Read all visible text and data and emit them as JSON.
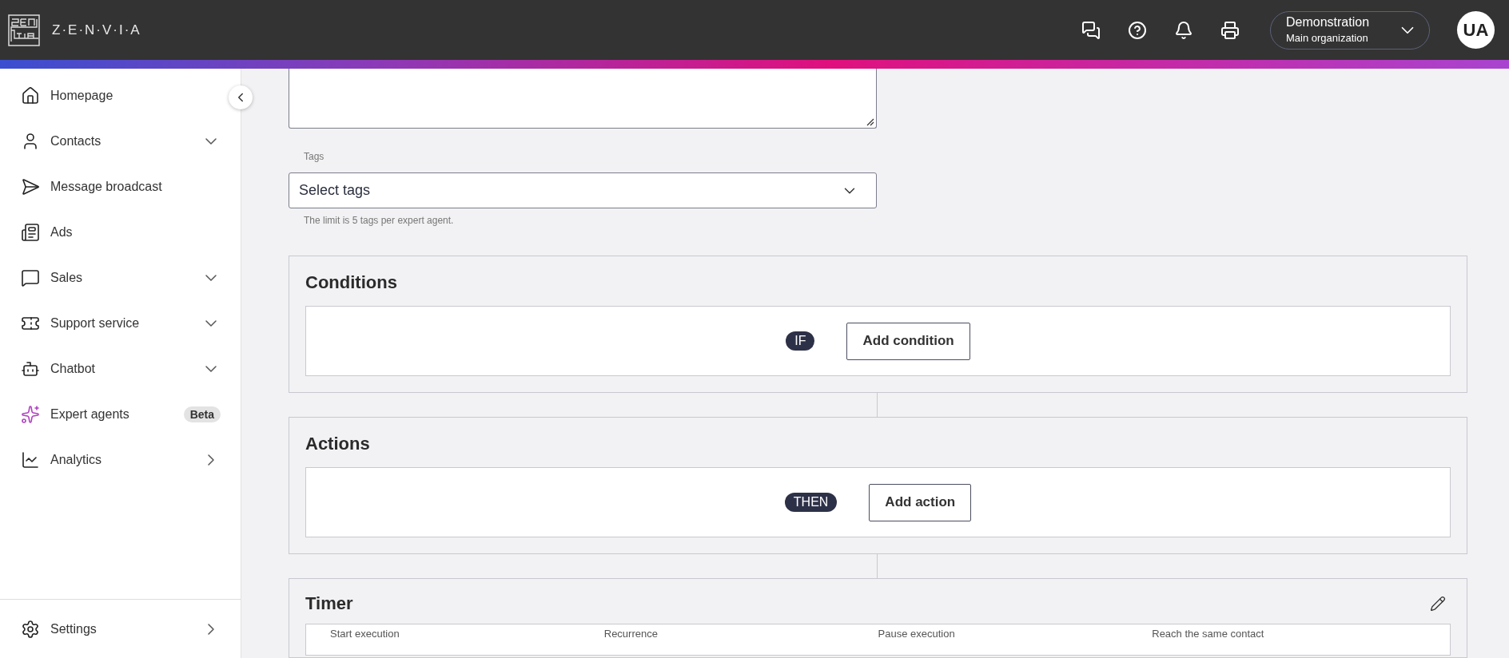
{
  "header": {
    "wordmark": "Z·E·N·V·I·A",
    "organization": {
      "name": "Demonstration",
      "subtitle": "Main organization"
    },
    "avatar": "UA"
  },
  "sidebar": {
    "items": [
      {
        "kind": "home",
        "label": "Homepage"
      },
      {
        "kind": "contacts",
        "label": "Contacts",
        "expandable": true
      },
      {
        "kind": "broadcast",
        "label": "Message broadcast"
      },
      {
        "kind": "ads",
        "label": "Ads"
      },
      {
        "kind": "sales",
        "label": "Sales",
        "expandable": true
      },
      {
        "kind": "support",
        "label": "Support service",
        "expandable": true
      },
      {
        "kind": "chatbot",
        "label": "Chatbot",
        "expandable": true
      },
      {
        "kind": "expert",
        "label": "Expert agents",
        "badge": "Beta"
      },
      {
        "kind": "analytics",
        "label": "Analytics",
        "submenu": true
      }
    ],
    "footer": {
      "kind": "settings",
      "label": "Settings",
      "submenu": true
    }
  },
  "form": {
    "tags": {
      "label": "Tags",
      "placeholder": "Select tags",
      "helper": "The limit is 5 tags per expert agent."
    }
  },
  "sections": [
    {
      "title": "Conditions",
      "tag": "IF",
      "button": "Add condition"
    },
    {
      "title": "Actions",
      "tag": "THEN",
      "button": "Add action"
    }
  ],
  "timer": {
    "title": "Timer",
    "columns": [
      "Start execution",
      "Recurrence",
      "Pause execution",
      "Reach the same contact"
    ]
  }
}
